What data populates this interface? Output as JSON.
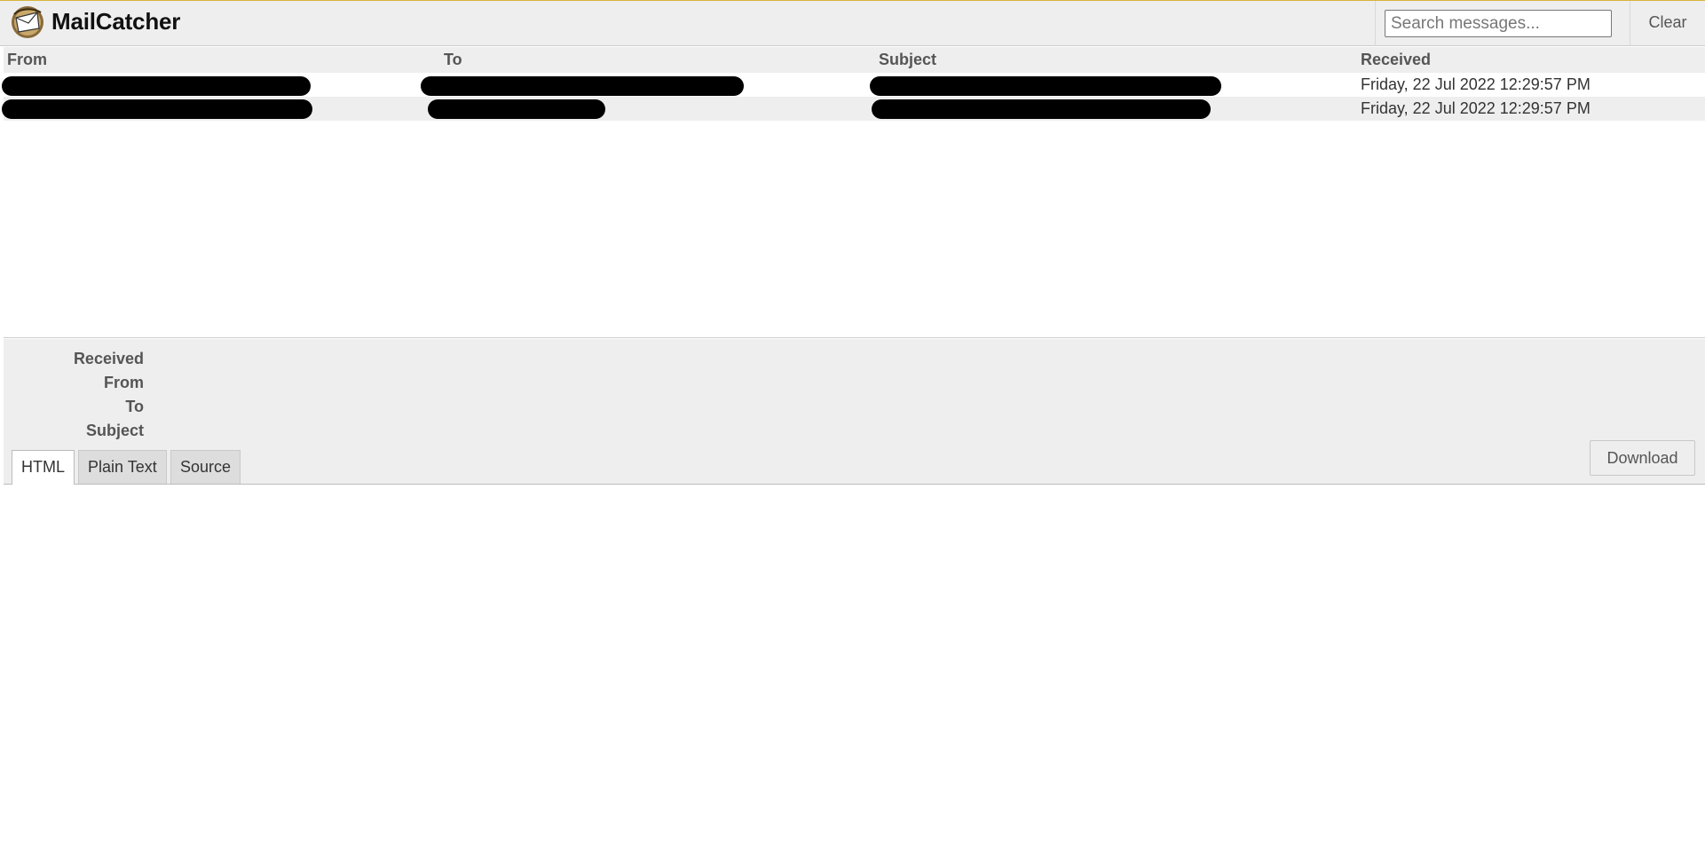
{
  "header": {
    "title": "MailCatcher",
    "search_placeholder": "Search messages...",
    "clear_label": "Clear",
    "accent_color": "#d8b53a"
  },
  "list": {
    "columns": [
      "From",
      "To",
      "Subject",
      "Received"
    ],
    "rows": [
      {
        "from": "",
        "to": "",
        "subject": "",
        "received": "Friday, 22 Jul 2022 12:29:57 PM"
      },
      {
        "from": "",
        "to": "",
        "subject": "",
        "received": "Friday, 22 Jul 2022 12:29:57 PM"
      }
    ]
  },
  "view": {
    "labels": {
      "received": "Received",
      "from": "From",
      "to": "To",
      "subject": "Subject"
    },
    "tabs": [
      "HTML",
      "Plain Text",
      "Source"
    ],
    "active_tab": "HTML",
    "download_label": "Download"
  },
  "icons": {
    "logo": "mailcatcher-logo-icon"
  }
}
